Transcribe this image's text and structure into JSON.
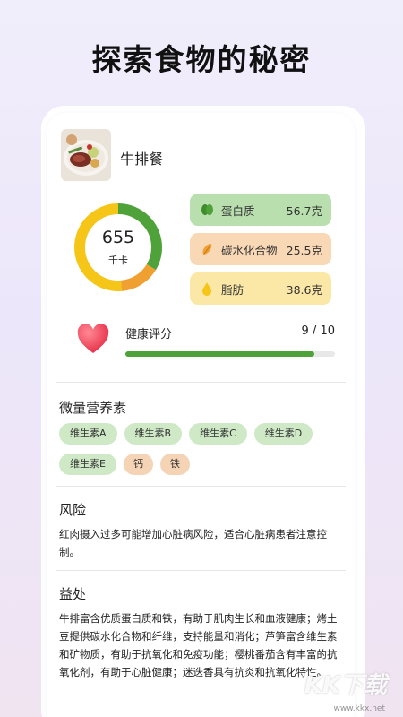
{
  "headline": "探索食物的秘密",
  "meal": {
    "name": "牛排餐",
    "image_icon": "steak-meal-photo"
  },
  "calories": {
    "value": "655",
    "unit": "千卡"
  },
  "macros": [
    {
      "label": "蛋白质",
      "value": "56.7克",
      "icon": "protein-icon",
      "color": "#b9dfae"
    },
    {
      "label": "碳水化合物",
      "value": "25.5克",
      "icon": "carb-icon",
      "color": "#f9d8b5"
    },
    {
      "label": "脂肪",
      "value": "38.6克",
      "icon": "fat-icon",
      "color": "#fbe8a6"
    }
  ],
  "health": {
    "label": "健康评分",
    "score": "9 / 10",
    "fraction": 0.9,
    "icon": "heart-icon"
  },
  "micronutrients": {
    "title": "微量营养素",
    "vitamins": [
      "维生素A",
      "维生素B",
      "维生素C",
      "维生素D",
      "维生素E"
    ],
    "minerals": [
      "钙",
      "铁"
    ]
  },
  "risk": {
    "title": "风险",
    "text": "红肉摄入过多可能增加心脏病风险，适合心脏病患者注意控制。"
  },
  "benefit": {
    "title": "益处",
    "text": "牛排富含优质蛋白质和铁，有助于肌肉生长和血液健康；烤土豆提供碳水化合物和纤维，支持能量和消化；芦笋富含维生素和矿物质，有助于抗氧化和免疫功能；樱桃番茄含有丰富的抗氧化剂，有助于心脏健康；迷迭香具有抗炎和抗氧化特性。"
  },
  "watermark": {
    "text": "KK下载",
    "url": "www.kkx.net"
  },
  "colors": {
    "green": "#4fa23a",
    "orange": "#f0a030",
    "yellow": "#f5c518",
    "heart": "#f0455a"
  }
}
